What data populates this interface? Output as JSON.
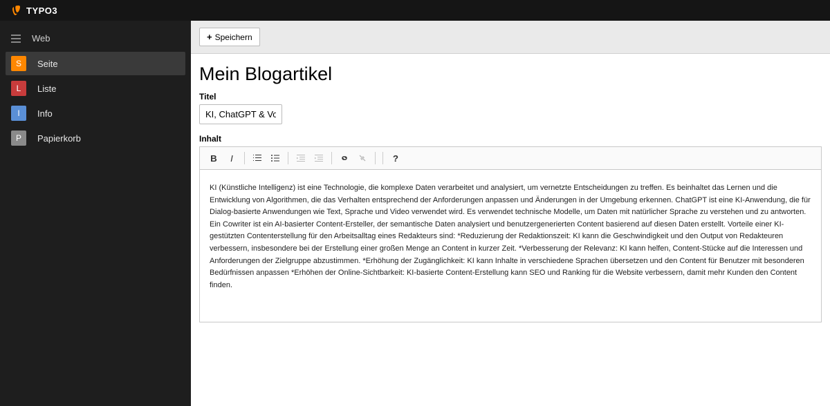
{
  "app": {
    "brand": "TYPO3"
  },
  "sidebar": {
    "group_label": "Web",
    "items": [
      {
        "letter": "S",
        "label": "Seite",
        "color": "#ff8700",
        "active": true
      },
      {
        "letter": "L",
        "label": "Liste",
        "color": "#c83c3c",
        "active": false
      },
      {
        "letter": "I",
        "label": "Info",
        "color": "#5a8fd6",
        "active": false
      },
      {
        "letter": "P",
        "label": "Papierkorb",
        "color": "#8a8a8a",
        "active": false
      }
    ]
  },
  "toolbar": {
    "save_label": "Speichern"
  },
  "page": {
    "heading": "Mein Blogartikel",
    "title_label": "Titel",
    "title_value": "KI, ChatGPT & Vorteile e",
    "content_label": "Inhalt",
    "content_body": "KI (Künstliche Intelligenz) ist eine Technologie, die komplexe Daten verarbeitet und analysiert, um vernetzte Entscheidungen zu treffen. Es beinhaltet das Lernen und die Entwicklung von Algorithmen, die das Verhalten entsprechend der Anforderungen anpassen und Änderungen in der Umgebung erkennen. ChatGPT ist eine KI-Anwendung, die für Dialog-basierte Anwendungen wie Text, Sprache und Video verwendet wird. Es verwendet technische Modelle, um Daten mit natürlicher Sprache zu verstehen und zu antworten. Ein Cowriter ist ein AI-basierter Content-Ersteller, der semantische Daten analysiert und benutzergenerierten Content basierend auf diesen Daten erstellt. Vorteile einer KI-gestützten Contenterstellung für den Arbeitsalltag eines Redakteurs sind: *Reduzierung der Redaktionszeit: KI kann die Geschwindigkeit und den Output von Redakteuren verbessern, insbesondere bei der Erstellung einer großen Menge an Content in kurzer Zeit. *Verbesserung der Relevanz: KI kann helfen, Content-Stücke auf die Interessen und Anforderungen der Zielgruppe abzustimmen. *Erhöhung der Zugänglichkeit: KI kann Inhalte in verschiedene Sprachen übersetzen und den Content für Benutzer mit besonderen Bedürfnissen anpassen *Erhöhen der Online-Sichtbarkeit: KI-basierte Content-Erstellung kann SEO und Ranking für die Website verbessern, damit mehr Kunden den Content finden."
  }
}
